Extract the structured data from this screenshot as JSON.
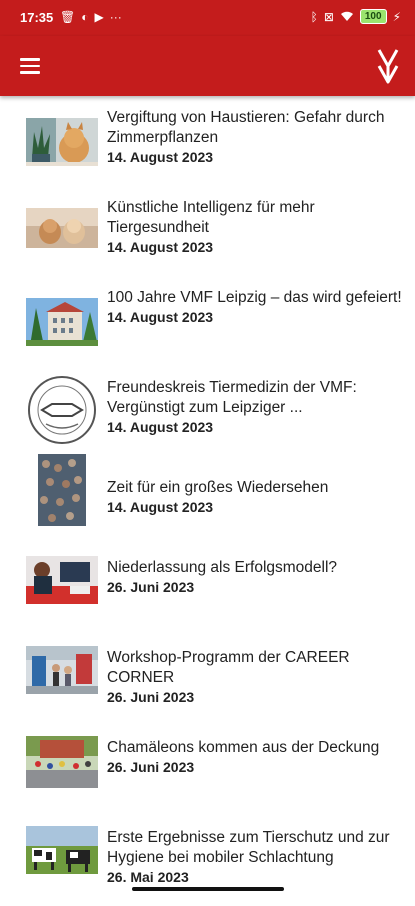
{
  "status": {
    "time": "17:35",
    "battery": "100"
  },
  "items": [
    {
      "title": "Vergiftung von Haustieren: Gefahr durch Zimmerpflanzen",
      "date": "14. August 2023",
      "thumb": "cat-plant"
    },
    {
      "title": "Künstliche Intelligenz für mehr Tiergesundheit",
      "date": "14. August 2023",
      "thumb": "dogs"
    },
    {
      "title": "100 Jahre VMF Leipzig – das wird gefeiert!",
      "date": "14. August 2023",
      "thumb": "building"
    },
    {
      "title": "Freundeskreis Tiermedizin der VMF: Vergünstigt zum Leipziger ...",
      "date": "14. August 2023",
      "thumb": "seal"
    },
    {
      "title": "Zeit für ein großes Wiedersehen",
      "date": "14. August 2023",
      "thumb": "crowd"
    },
    {
      "title": "Niederlassung als Erfolgsmodell?",
      "date": "26. Juni 2023",
      "thumb": "office"
    },
    {
      "title": "Workshop-Programm der CAREER CORNER",
      "date": "26. Juni 2023",
      "thumb": "fair"
    },
    {
      "title": "Chamäleons kommen aus der Deckung",
      "date": "26. Juni 2023",
      "thumb": "street"
    },
    {
      "title": "Erste Ergebnisse zum Tierschutz und zur Hygiene bei mobiler Schlachtung",
      "date": "26. Mai 2023",
      "thumb": "cows"
    }
  ]
}
